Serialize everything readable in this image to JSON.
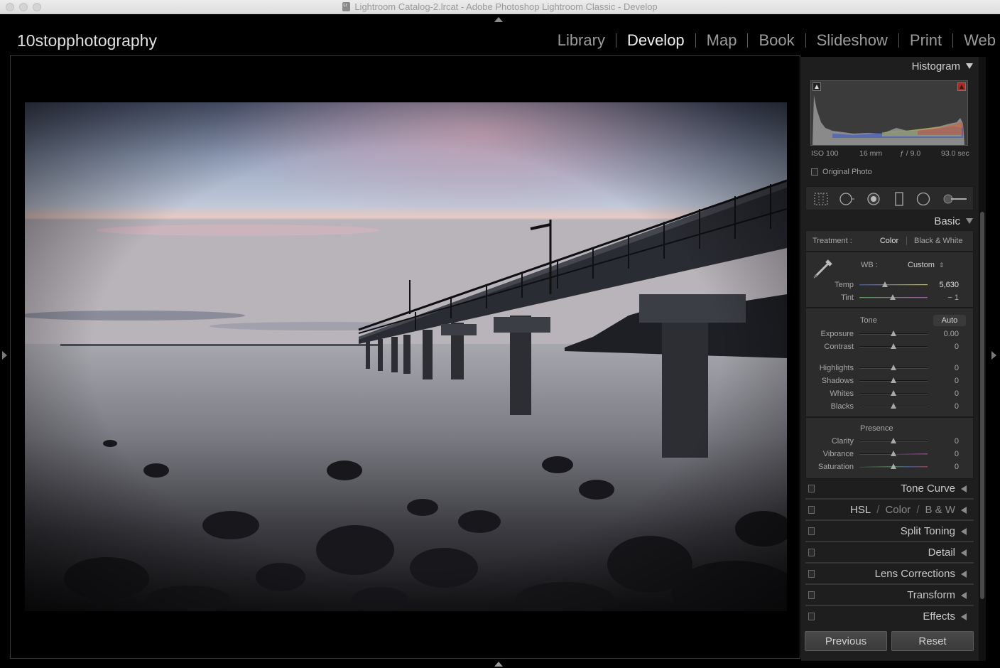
{
  "window": {
    "title": "Lightroom Catalog-2.lrcat - Adobe Photoshop Lightroom Classic - Develop"
  },
  "identity_plate": "10stopphotography",
  "modules": [
    {
      "label": "Library",
      "active": false
    },
    {
      "label": "Develop",
      "active": true
    },
    {
      "label": "Map",
      "active": false
    },
    {
      "label": "Book",
      "active": false
    },
    {
      "label": "Slideshow",
      "active": false
    },
    {
      "label": "Print",
      "active": false
    },
    {
      "label": "Web",
      "active": false
    }
  ],
  "histogram": {
    "title": "Histogram",
    "iso": "ISO 100",
    "focal": "16 mm",
    "aperture": "ƒ / 9.0",
    "shutter": "93.0 sec",
    "original_photo_label": "Original Photo",
    "original_photo_checked": false
  },
  "basic": {
    "title": "Basic",
    "treatment_label": "Treatment :",
    "treatment_color": "Color",
    "treatment_bw": "Black & White",
    "treatment_selected": "Color",
    "wb_label": "WB :",
    "wb_value": "Custom",
    "temp_label": "Temp",
    "temp_value": "5,630",
    "temp_level": 0.37,
    "tint_label": "Tint",
    "tint_value": "− 1",
    "tint_level": 0.49,
    "tone_label": "Tone",
    "auto_label": "Auto",
    "exposure_label": "Exposure",
    "exposure_value": "0.00",
    "contrast_label": "Contrast",
    "contrast_value": "0",
    "highlights_label": "Highlights",
    "highlights_value": "0",
    "shadows_label": "Shadows",
    "shadows_value": "0",
    "whites_label": "Whites",
    "whites_value": "0",
    "blacks_label": "Blacks",
    "blacks_value": "0",
    "presence_label": "Presence",
    "clarity_label": "Clarity",
    "clarity_value": "0",
    "vibrance_label": "Vibrance",
    "vibrance_value": "0",
    "saturation_label": "Saturation",
    "saturation_value": "0"
  },
  "panels": {
    "tone_curve": "Tone Curve",
    "hsl": "HSL",
    "hsl_sep1": "/",
    "hsl_color": "Color",
    "hsl_sep2": "/",
    "hsl_bw": "B & W",
    "split_toning": "Split Toning",
    "detail": "Detail",
    "lens_corrections": "Lens Corrections",
    "transform": "Transform",
    "effects": "Effects"
  },
  "buttons": {
    "previous": "Previous",
    "reset": "Reset"
  },
  "colors": {
    "accent_active": "#f0f0f0",
    "panel_bg": "#1e1e1e",
    "histogram_clip_warning": "#c0201c"
  },
  "icons": {
    "tools": [
      "crop-overlay-icon",
      "spot-removal-icon",
      "red-eye-icon",
      "graduated-filter-icon",
      "radial-filter-icon",
      "adjustment-brush-icon"
    ]
  }
}
